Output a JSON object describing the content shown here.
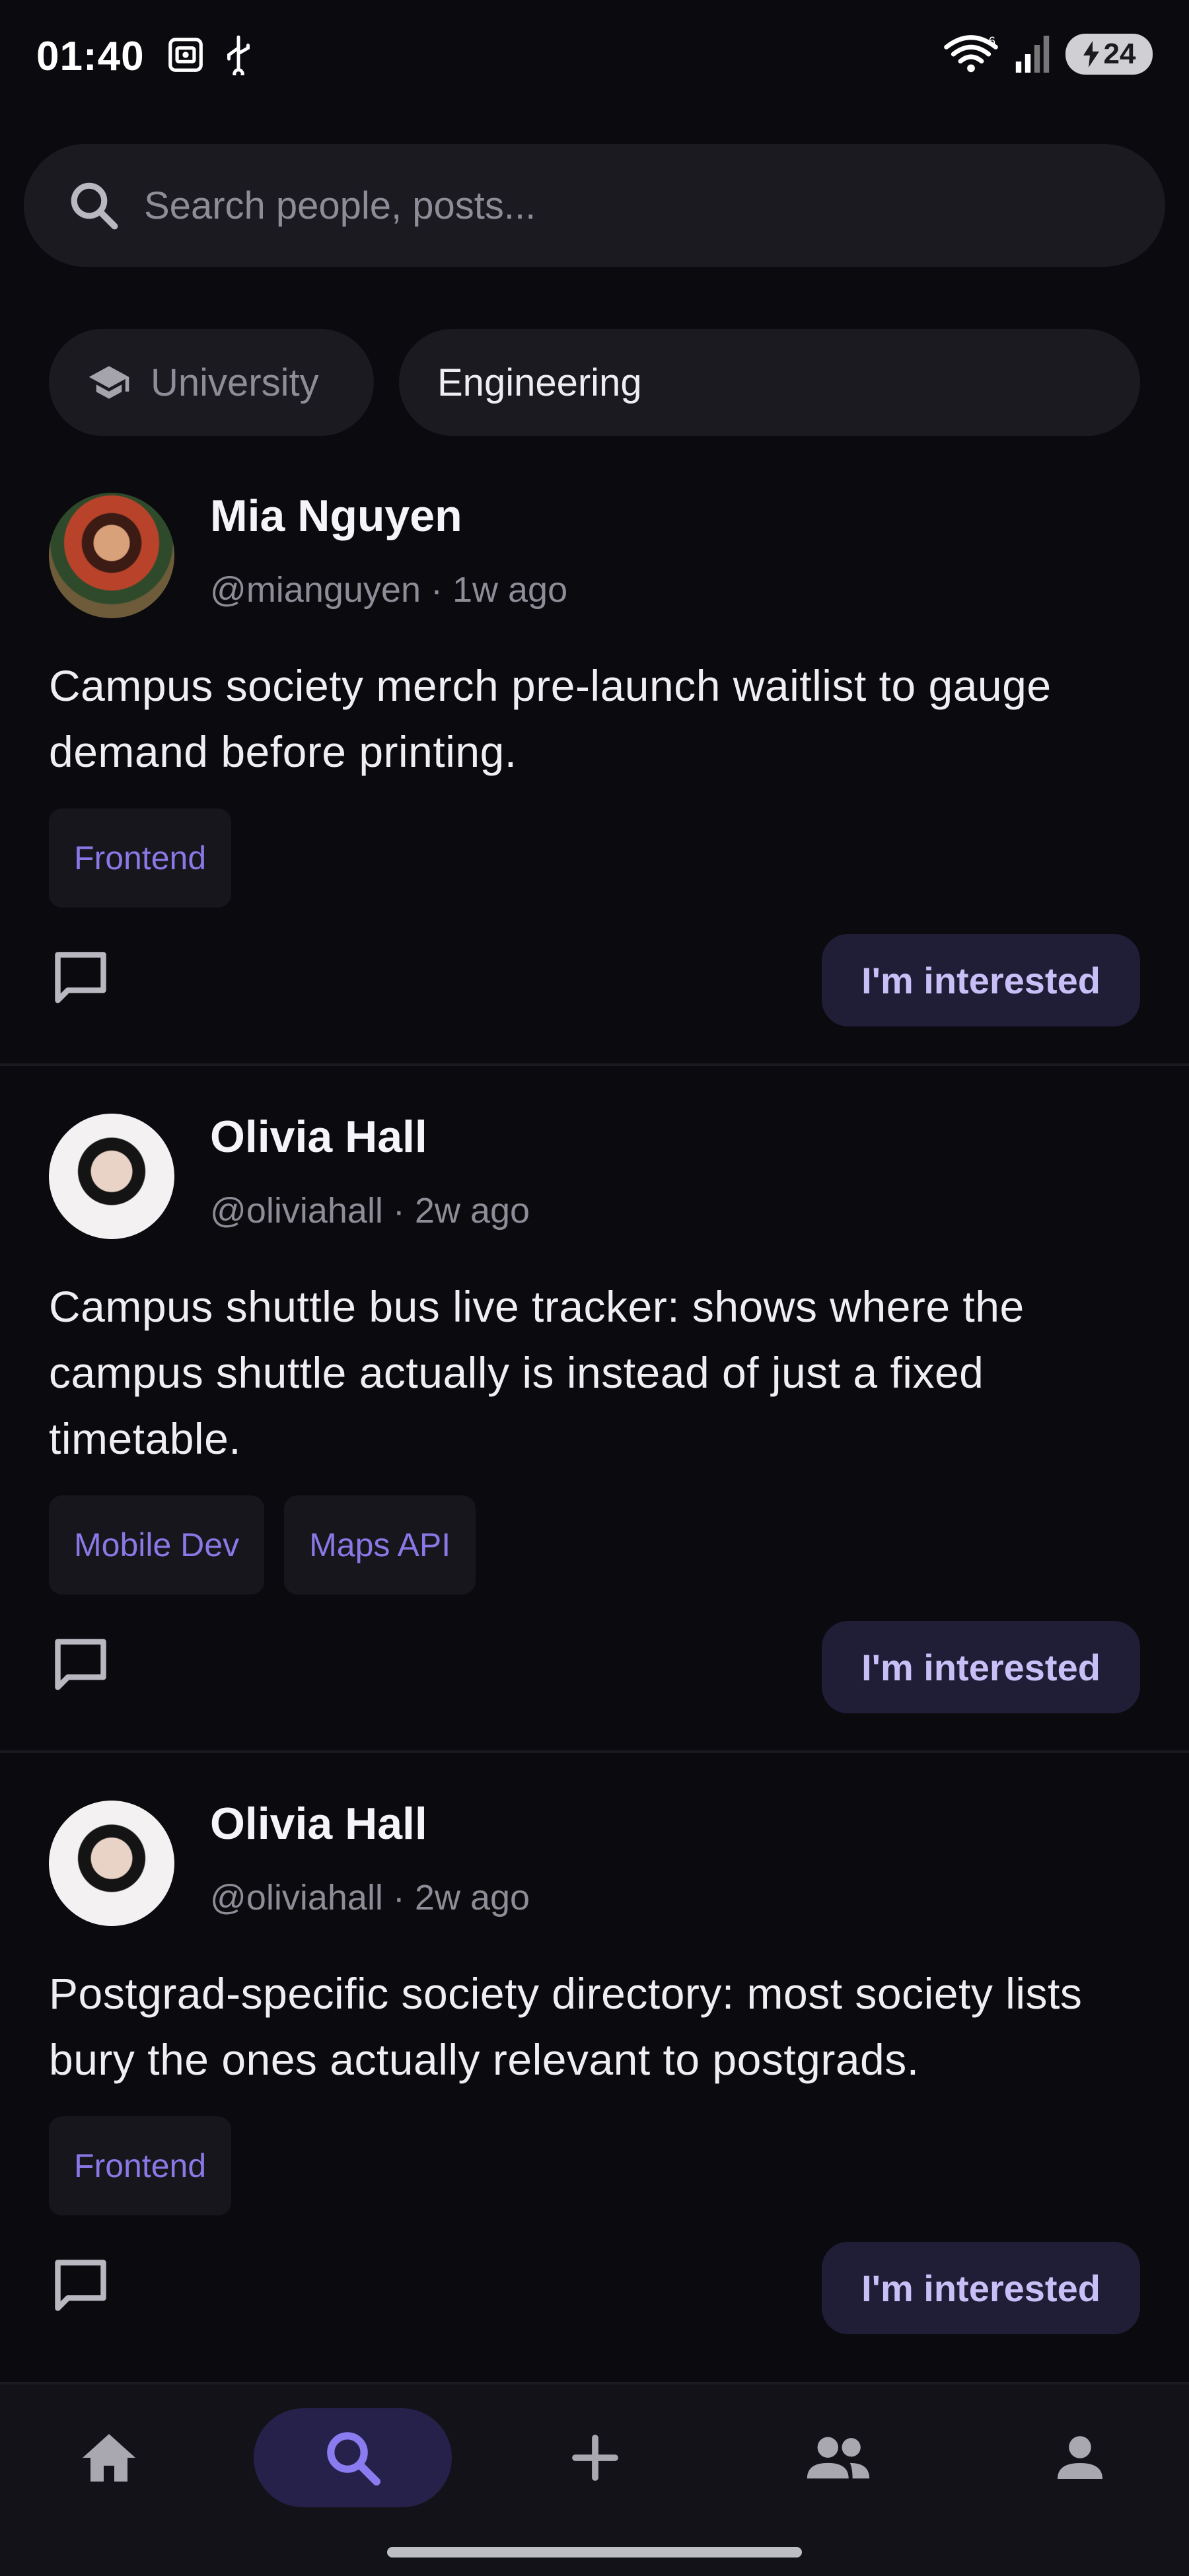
{
  "status_bar": {
    "time": "01:40",
    "wifi_badge": "6",
    "battery_level": "24",
    "icons": [
      "screenshot-icon",
      "usb-icon",
      "wifi-icon",
      "signal-icon",
      "battery-charging-icon"
    ]
  },
  "search": {
    "placeholder": "Search people, posts..."
  },
  "filters": {
    "university_label": "University",
    "engineering_label": "Engineering"
  },
  "posts": [
    {
      "author": "Mia Nguyen",
      "meta": "@mianguyen · 1w ago",
      "body": "Campus society merch pre-launch waitlist to gauge demand before printing.",
      "tags": [
        "Frontend"
      ],
      "action_label": "I'm interested"
    },
    {
      "author": "Olivia Hall",
      "meta": "@oliviahall · 2w ago",
      "body": "Campus shuttle bus live tracker: shows where the campus shuttle actually is instead of just a fixed timetable.",
      "tags": [
        "Mobile Dev",
        "Maps API"
      ],
      "action_label": "I'm interested"
    },
    {
      "author": "Olivia Hall",
      "meta": "@oliviahall · 2w ago",
      "body": "Postgrad-specific society directory: most society lists bury the ones actually relevant to postgrads.",
      "tags": [
        "Frontend"
      ],
      "action_label": "I'm interested"
    }
  ],
  "bottom_nav": {
    "items": [
      "home-icon",
      "search-icon",
      "add-icon",
      "people-icon",
      "profile-icon"
    ],
    "active": "search-icon"
  },
  "colors": {
    "background": "#0b0a0f",
    "surface": "#1b1a21",
    "accent": "#8a78e6",
    "button_bg": "#201d37",
    "button_text": "#c8bff7"
  }
}
